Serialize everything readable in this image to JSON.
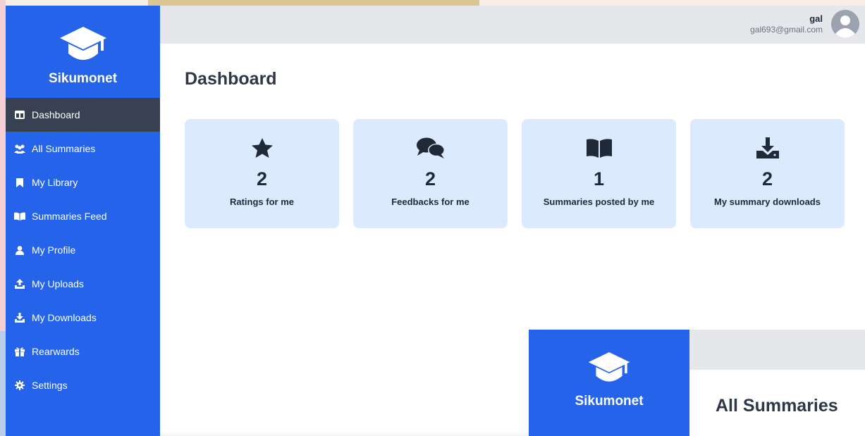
{
  "brand": {
    "name": "Sikumonet",
    "icon": "graduation-cap-icon"
  },
  "user": {
    "name": "gal",
    "email": "gal693@gmail.com"
  },
  "sidebar": {
    "items": [
      {
        "label": "Dashboard",
        "icon": "columns-icon",
        "active": true
      },
      {
        "label": "All Summaries",
        "icon": "people-group-icon",
        "active": false
      },
      {
        "label": "My Library",
        "icon": "bookmark-icon",
        "active": false
      },
      {
        "label": "Summaries Feed",
        "icon": "book-open-icon",
        "active": false
      },
      {
        "label": "My Profile",
        "icon": "user-icon",
        "active": false
      },
      {
        "label": "My Uploads",
        "icon": "upload-icon",
        "active": false
      },
      {
        "label": "My Downloads",
        "icon": "download-icon",
        "active": false
      },
      {
        "label": "Rearwards",
        "icon": "gift-icon",
        "active": false
      },
      {
        "label": "Settings",
        "icon": "gear-icon",
        "active": false
      }
    ]
  },
  "main": {
    "title": "Dashboard",
    "cards": [
      {
        "count": "2",
        "label": "Ratings for me",
        "icon": "star-icon"
      },
      {
        "count": "2",
        "label": "Feedbacks for me",
        "icon": "comments-icon"
      },
      {
        "count": "1",
        "label": "Summaries posted by me",
        "icon": "book-open-icon"
      },
      {
        "count": "2",
        "label": "My summary downloads",
        "icon": "download-tray-icon"
      }
    ]
  },
  "preview": {
    "brand_name": "Sikumonet",
    "title": "All Summaries"
  },
  "colors": {
    "sidebar": "#2563eb",
    "active_item": "#374151",
    "card": "#dbeafe",
    "topbar": "#e5e7eb"
  }
}
